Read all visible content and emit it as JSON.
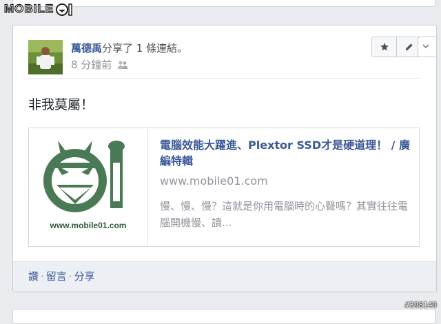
{
  "watermark": {
    "logo_text": "MOBILE",
    "id": "#398149"
  },
  "post": {
    "author": "萬德禹",
    "action_text": "分享了 1 條連結。",
    "timestamp": "8 分鐘前",
    "message": "非我莫屬！"
  },
  "link": {
    "title": "電腦效能大躍進、Plextor SSD才是硬道理！ / 廣編特輯",
    "url": "www.mobile01.com",
    "description": "慢、慢、慢？這就是你用電腦時的心聲嗎？其實往往電腦開機慢、讀...",
    "thumb_caption": "www.mobile01.com",
    "thumb_color": "#4a7a55"
  },
  "actions": {
    "read": "讚",
    "comment": "留言",
    "share": "分享"
  },
  "colors": {
    "link_blue": "#3b5998",
    "muted": "#90949c"
  }
}
